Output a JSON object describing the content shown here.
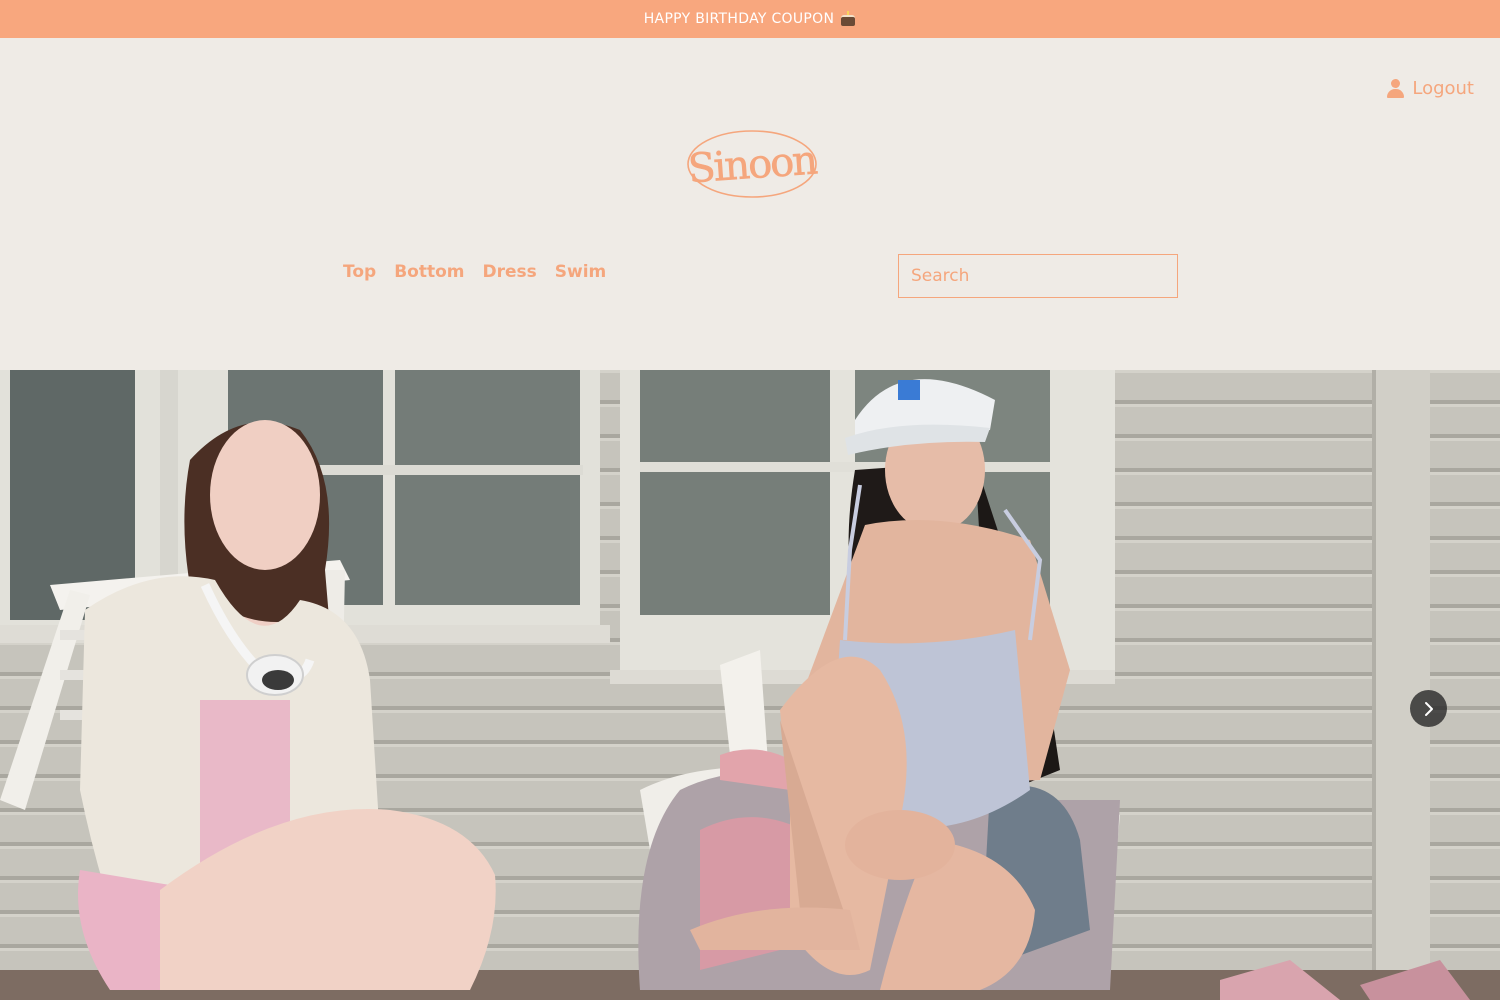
{
  "announcement": {
    "text": "HAPPY BIRTHDAY COUPON",
    "icon": "cake-icon"
  },
  "header": {
    "logout_label": "Logout",
    "logout_icon": "user-icon",
    "logo_text": "Sinoon",
    "nav": [
      {
        "label": "Top"
      },
      {
        "label": "Bottom"
      },
      {
        "label": "Dress"
      },
      {
        "label": "Swim"
      }
    ],
    "search": {
      "placeholder": "Search",
      "value": ""
    }
  },
  "hero": {
    "next_icon": "chevron-right-icon"
  },
  "colors": {
    "accent": "#f8a77e",
    "text_accent": "#f5a67d",
    "background": "#efebe6"
  }
}
